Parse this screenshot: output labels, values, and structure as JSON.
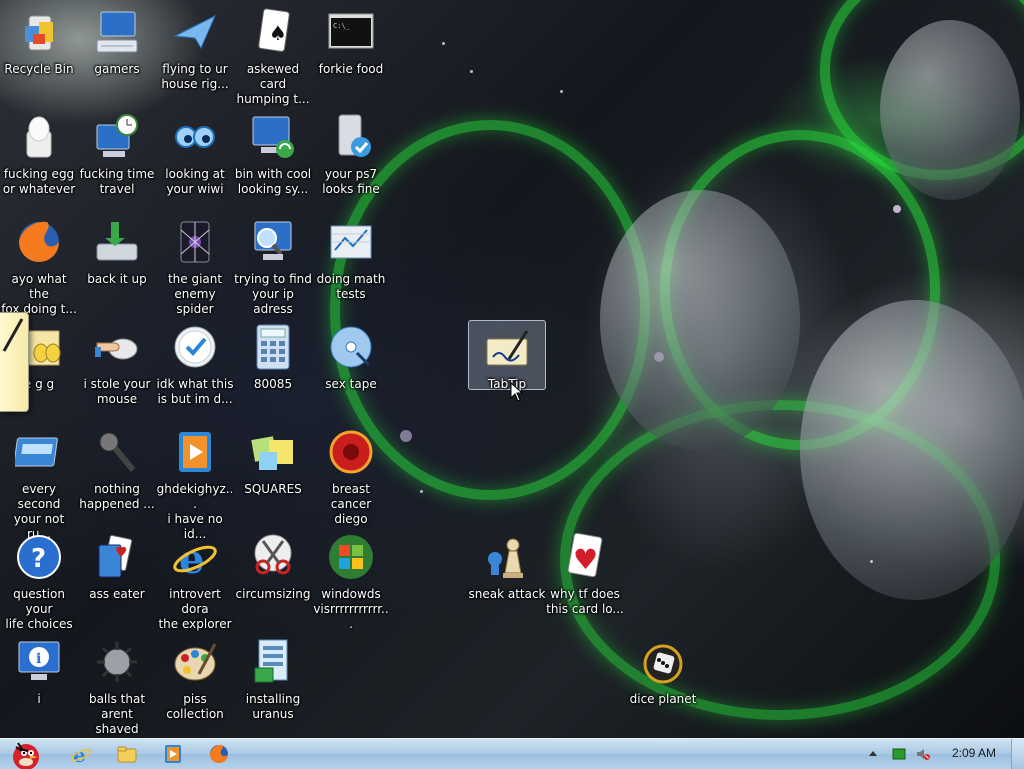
{
  "desktop": {
    "icons": [
      {
        "label": "Recycle Bin",
        "icon": "recycle-bin-icon"
      },
      {
        "label": "gamers",
        "icon": "computer-keyboard-icon"
      },
      {
        "label": "flying to ur\nhouse rig...",
        "icon": "paper-plane-icon"
      },
      {
        "label": "askewed card\nhumping t...",
        "icon": "spade-card-icon"
      },
      {
        "label": "forkie food",
        "icon": "command-prompt-icon"
      },
      {
        "label": "fucking egg\nor whatever",
        "icon": "egg-icon"
      },
      {
        "label": "fucking time\ntravel",
        "icon": "computer-clock-icon"
      },
      {
        "label": "looking at\nyour wiwi",
        "icon": "eyes-icon"
      },
      {
        "label": "bin with cool\nlooking sy...",
        "icon": "computer-sync-icon"
      },
      {
        "label": "your ps7\nlooks fine",
        "icon": "drive-check-icon"
      },
      {
        "label": "ayo what the\nfox doing t...",
        "icon": "firefox-icon"
      },
      {
        "label": "back it up",
        "icon": "backup-icon"
      },
      {
        "label": "the giant\nenemy spider",
        "icon": "spider-solitaire-icon"
      },
      {
        "label": "trying to find\nyour ip adress",
        "icon": "network-search-icon"
      },
      {
        "label": "doing math\ntests",
        "icon": "math-chart-icon"
      },
      {
        "label": "e g g",
        "icon": "eggs-icon"
      },
      {
        "label": "i stole your\nmouse",
        "icon": "mouse-hand-icon"
      },
      {
        "label": "idk what this\nis but im d...",
        "icon": "clock-check-icon"
      },
      {
        "label": "80085",
        "icon": "calculator-icon"
      },
      {
        "label": "sex tape",
        "icon": "dvd-icon"
      },
      {
        "label": "every second\nyour not ru...",
        "icon": "window-frame-icon"
      },
      {
        "label": "nothing\nhappened ...",
        "icon": "microphone-icon"
      },
      {
        "label": "ghdekighyz...\ni have no id...",
        "icon": "media-player-icon"
      },
      {
        "label": "SQUARES",
        "icon": "sticky-notes-icon"
      },
      {
        "label": "breast cancer\ndiego",
        "icon": "red-disc-icon"
      },
      {
        "label": "question your\nlife choices",
        "icon": "help-icon"
      },
      {
        "label": "ass eater",
        "icon": "cards-icon"
      },
      {
        "label": "introvert dora\nthe explorer",
        "icon": "internet-explorer-icon"
      },
      {
        "label": "circumsizing",
        "icon": "scissors-icon"
      },
      {
        "label": "windowds\nvisrrrrrrrrrrr...",
        "icon": "windows-logo-icon"
      },
      {
        "label": "i",
        "icon": "info-monitor-icon"
      },
      {
        "label": "balls that\narent shaved",
        "icon": "spiked-ball-icon"
      },
      {
        "label": "piss\ncollection",
        "icon": "paint-palette-icon"
      },
      {
        "label": "installing\nuranus",
        "icon": "installer-icon"
      },
      {
        "label": "TabTip",
        "icon": "tablet-pen-icon"
      },
      {
        "label": "sneak attack",
        "icon": "chess-icon"
      },
      {
        "label": "why tf does\nthis card lo...",
        "icon": "heart-card-icon"
      },
      {
        "label": "dice planet",
        "icon": "dice-icon"
      }
    ]
  },
  "taskbar": {
    "start": "angry-bird-start-icon",
    "pinned": [
      "internet-explorer-icon",
      "folder-icon",
      "media-player-icon",
      "firefox-icon"
    ],
    "tray": [
      "up-arrow-icon",
      "battery-icon",
      "volume-muted-icon"
    ],
    "clock": "2:09 AM"
  }
}
